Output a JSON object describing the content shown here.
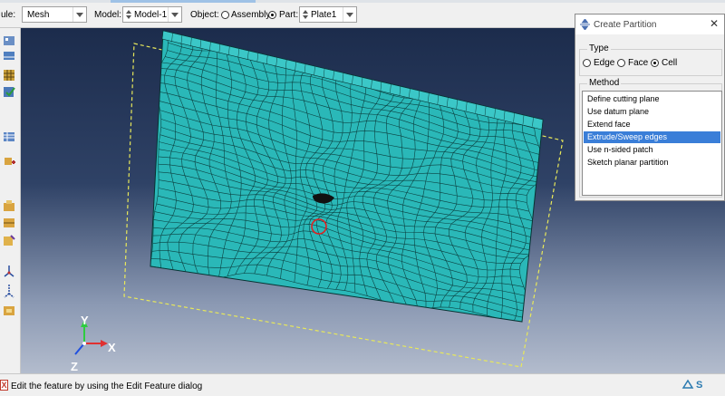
{
  "toolbar": {
    "module_label": "ule:",
    "module_value": "Mesh",
    "model_label": "Model:",
    "model_value": "Model-1",
    "object_label": "Object:",
    "assembly_label": "Assembly",
    "part_label": "Part:",
    "part_value": "Plate1",
    "object_selected": "Part"
  },
  "left_toolbar_icons": [
    "seed-part-icon",
    "seed-edge-icon",
    "mesh-part-icon",
    "verify-mesh-icon",
    "mesh-controls-icon",
    "element-type-icon",
    "partition-cell-icon",
    "partition-face-icon",
    "partition-edge-icon",
    "datum-point-icon",
    "datum-axis-icon",
    "feature-manager-icon"
  ],
  "viewport": {
    "triad": {
      "y_label": "Y",
      "x_label": "X",
      "z_label": "Z"
    }
  },
  "dialog": {
    "title": "Create Partition",
    "type_group": "Type",
    "type_options": [
      "Edge",
      "Face",
      "Cell"
    ],
    "type_selected": "Cell",
    "method_group": "Method",
    "methods": [
      "Define cutting plane",
      "Use datum plane",
      "Extend face",
      "Extrude/Sweep edges",
      "Use n-sided patch",
      "Sketch planar partition"
    ],
    "method_selected_index": 3
  },
  "status": {
    "message": "Edit the feature by using the Edit Feature dialog",
    "brand": "S"
  },
  "colors": {
    "mesh_fill": "#2ab8b8",
    "mesh_line": "#0b3a3a",
    "viewport_top": "#1c2c4c",
    "viewport_bottom": "#b3bccd",
    "selection": "#3a7ed8",
    "dashed_outline": "#e8e85a"
  }
}
